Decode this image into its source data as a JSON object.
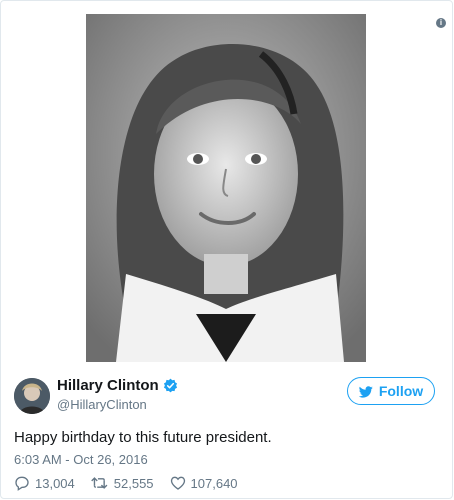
{
  "tweet": {
    "display_name": "Hillary Clinton",
    "handle": "@HillaryClinton",
    "text": "Happy birthday to this future president.",
    "timestamp": "6:03 AM - Oct 26, 2016",
    "follow_label": "Follow",
    "replies": "13,004",
    "retweets": "52,555",
    "likes": "107,640"
  },
  "icons": {
    "info": "info-icon",
    "verified": "verified-badge-icon",
    "follow": "twitter-bird-icon",
    "reply": "reply-icon",
    "retweet": "retweet-icon",
    "like": "heart-icon"
  },
  "colors": {
    "accent": "#1da1f2",
    "secondary_text": "#657786",
    "primary_text": "#14171a"
  }
}
